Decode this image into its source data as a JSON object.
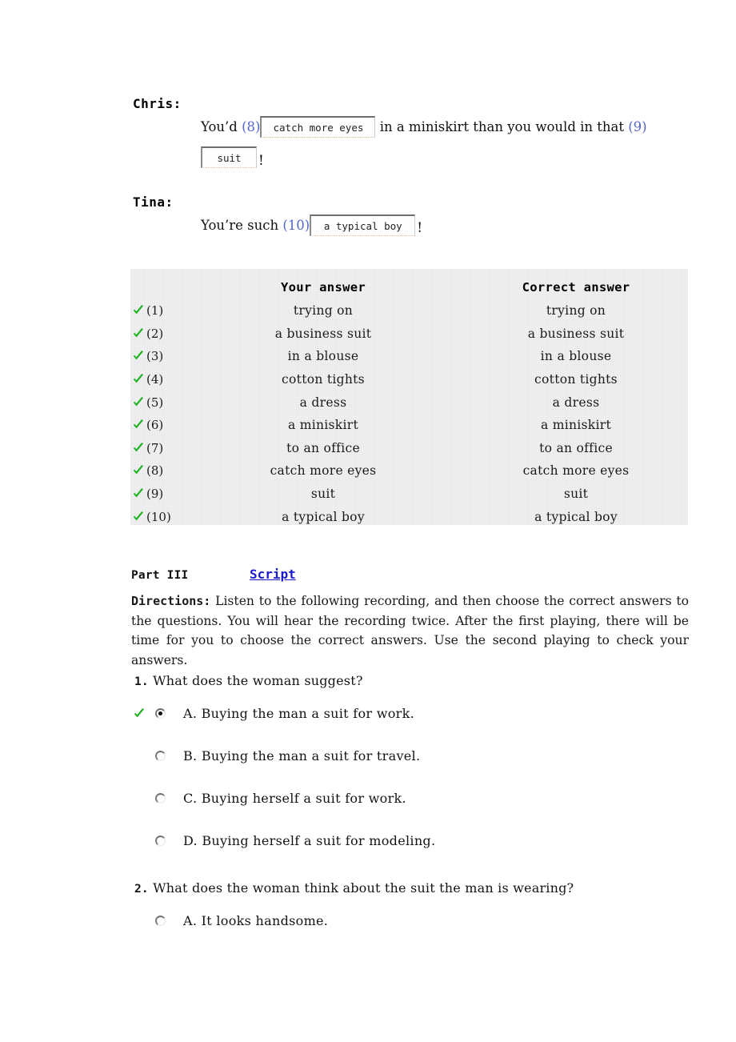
{
  "dialogue": [
    {
      "speaker": "Chris:",
      "pre1": "You’d ",
      "num1": "(8)",
      "box1": "catch more eyes",
      "mid": " in a miniskirt than you would in that ",
      "num2": "(9)",
      "box2": "suit",
      "excl": "!"
    },
    {
      "speaker": "Tina:",
      "pre1": "You’re such ",
      "num1": "(10)",
      "box1": "a typical boy",
      "excl": "!"
    }
  ],
  "answer_table": {
    "headers": {
      "your": "Your answer",
      "correct": "Correct answer"
    },
    "rows": [
      {
        "mark": "check",
        "index": "(1)",
        "your": "trying on",
        "correct": "trying on"
      },
      {
        "mark": "check",
        "index": "(2)",
        "your": "a business suit",
        "correct": "a business suit"
      },
      {
        "mark": "check",
        "index": "(3)",
        "your": "in a blouse",
        "correct": "in a blouse"
      },
      {
        "mark": "check",
        "index": "(4)",
        "your": "cotton tights",
        "correct": "cotton tights"
      },
      {
        "mark": "check",
        "index": "(5)",
        "your": "a dress",
        "correct": "a dress"
      },
      {
        "mark": "check",
        "index": "(6)",
        "your": "a miniskirt",
        "correct": "a miniskirt"
      },
      {
        "mark": "check",
        "index": "(7)",
        "your": "to an office",
        "correct": "to an office"
      },
      {
        "mark": "check",
        "index": "(8)",
        "your": "catch more eyes",
        "correct": "catch more eyes"
      },
      {
        "mark": "check",
        "index": "(9)",
        "your": "suit",
        "correct": "suit"
      },
      {
        "mark": "check",
        "index": "(10)",
        "your": "a typical boy",
        "correct": "a typical boy"
      }
    ]
  },
  "part3": {
    "label": "Part III",
    "script_link": "Script",
    "directions_label": "Directions:",
    "directions_text": " Listen to the following recording, and then choose the correct answers to the questions. You will hear the recording twice. After the first playing, there will be time for you to choose the correct answers. Use the second playing to check your answers."
  },
  "questions": [
    {
      "number": "1.",
      "text": " What does the woman suggest?",
      "options": [
        {
          "letter": "A.",
          "label": "A.  Buying the man a suit for work.",
          "selected": true,
          "correct_mark": true
        },
        {
          "letter": "B.",
          "label": "B.  Buying the man a suit for travel.",
          "selected": false,
          "correct_mark": false
        },
        {
          "letter": "C.",
          "label": "C.  Buying herself a suit for work.",
          "selected": false,
          "correct_mark": false
        },
        {
          "letter": "D.",
          "label": "D.  Buying herself a suit for modeling.",
          "selected": false,
          "correct_mark": false
        }
      ]
    },
    {
      "number": "2.",
      "text": " What does the woman think about the suit the man is wearing?",
      "options": [
        {
          "letter": "A.",
          "label": "A.  It looks handsome.",
          "selected": false,
          "correct_mark": false
        }
      ]
    }
  ],
  "colors": {
    "blank_number": "#5566cc",
    "link": "#1919d0",
    "check_green": "#1fb11f",
    "table_bg": "#f2f2f2"
  }
}
